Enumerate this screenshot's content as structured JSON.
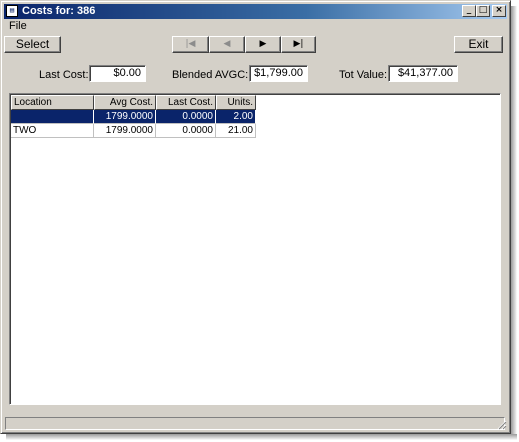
{
  "window": {
    "title": "Costs for: 386",
    "icon": "app-icon",
    "minimize_glyph": "_",
    "maximize_glyph": "□",
    "close_glyph": "×"
  },
  "menu": {
    "items": [
      {
        "label": "File"
      }
    ]
  },
  "toolbar": {
    "select_label": "Select",
    "exit_label": "Exit",
    "nav": {
      "first_glyph": "|◀",
      "prev_glyph": "◀",
      "next_glyph": "▶",
      "last_glyph": "▶|"
    }
  },
  "summary": {
    "last_cost_label": "Last Cost:",
    "last_cost_value": "$0.00",
    "blended_label": "Blended AVGC:",
    "blended_value": "$1,799.00",
    "tot_value_label": "Tot Value:",
    "tot_value_value": "$41,377.00"
  },
  "grid": {
    "columns": [
      "Location",
      "Avg Cost.",
      "Last Cost.",
      "Units."
    ],
    "rows": [
      {
        "location": "",
        "avg_cost": "1799.0000",
        "last_cost": "0.0000",
        "units": "2.00",
        "selected": true
      },
      {
        "location": "TWO",
        "avg_cost": "1799.0000",
        "last_cost": "0.0000",
        "units": "21.00",
        "selected": false
      }
    ]
  },
  "colors": {
    "titlebar_start": "#0a246a",
    "titlebar_end": "#a6caf0",
    "window_face": "#d4d0c8",
    "selection": "#0a246a"
  }
}
